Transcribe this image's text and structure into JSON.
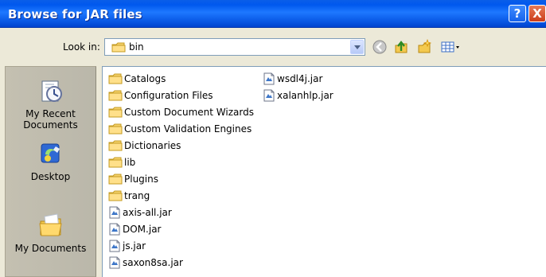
{
  "window": {
    "title": "Browse for JAR files",
    "help_button": "?",
    "close_button": "X"
  },
  "look_in": {
    "label": "Look in:",
    "selected_value": "bin"
  },
  "toolbar": {
    "icons": [
      "back-icon",
      "up-folder-icon",
      "new-folder-icon",
      "view-menu-icon"
    ]
  },
  "places_bar": {
    "items": [
      {
        "label": "My Recent\nDocuments",
        "icon": "recent-documents-icon"
      },
      {
        "label": "Desktop",
        "icon": "desktop-icon"
      },
      {
        "label": "My Documents",
        "icon": "my-documents-icon"
      }
    ]
  },
  "file_list": {
    "column_1": [
      {
        "name": "Catalogs",
        "type": "folder"
      },
      {
        "name": "Configuration Files",
        "type": "folder"
      },
      {
        "name": "Custom Document Wizards",
        "type": "folder"
      },
      {
        "name": "Custom Validation Engines",
        "type": "folder"
      },
      {
        "name": "Dictionaries",
        "type": "folder"
      },
      {
        "name": "lib",
        "type": "folder"
      },
      {
        "name": "Plugins",
        "type": "folder"
      },
      {
        "name": "trang",
        "type": "folder"
      },
      {
        "name": "axis-all.jar",
        "type": "jar"
      },
      {
        "name": "DOM.jar",
        "type": "jar"
      },
      {
        "name": "js.jar",
        "type": "jar"
      },
      {
        "name": "saxon8sa.jar",
        "type": "jar"
      }
    ],
    "column_2": [
      {
        "name": "wsdl4j.jar",
        "type": "jar"
      },
      {
        "name": "xalanhlp.jar",
        "type": "jar"
      }
    ]
  },
  "colors": {
    "title_bar": "#0058ee",
    "dialog_background": "#ece9d8",
    "places_bar": "#c4c0b1",
    "folder": "#f5d16a",
    "list_background": "#ffffff"
  }
}
